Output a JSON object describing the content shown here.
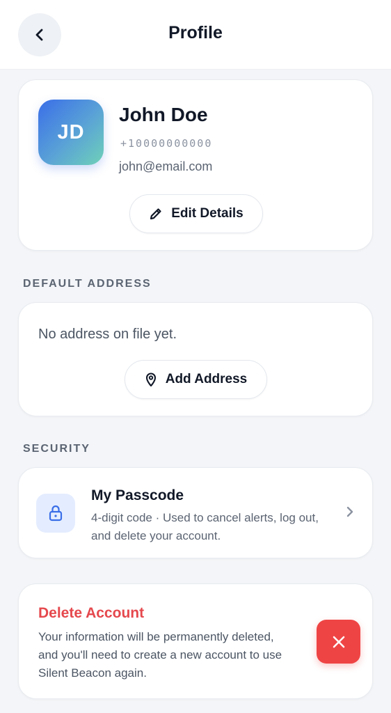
{
  "header": {
    "title": "Profile",
    "back_icon": "chevron-left-icon"
  },
  "profile": {
    "initials": "JD",
    "name": "John Doe",
    "phone": "+10000000000",
    "email": "john@email.com",
    "edit_label": "Edit Details",
    "edit_icon": "pencil-icon"
  },
  "address": {
    "section_label": "DEFAULT ADDRESS",
    "empty_text": "No address on file yet.",
    "add_label": "Add Address",
    "add_icon": "map-pin-icon"
  },
  "security": {
    "section_label": "SECURITY",
    "passcode_title": "My Passcode",
    "passcode_desc": "4-digit code · Used to cancel alerts, log out, and delete your account.",
    "lock_icon": "lock-icon",
    "chevron_icon": "chevron-right-icon"
  },
  "delete_account": {
    "title": "Delete Account",
    "description": "Your information will be permanently deleted, and you'll need to create a new account to use Silent Beacon again.",
    "icon": "close-icon"
  },
  "colors": {
    "background": "#f3f5f8",
    "card": "#ffffff",
    "text_primary": "#111827",
    "text_secondary": "#5b6472",
    "danger": "#ef4444",
    "danger_text": "#e5484d",
    "accent_blue": "#3a6ee8",
    "lock_bg": "#e4edff"
  }
}
